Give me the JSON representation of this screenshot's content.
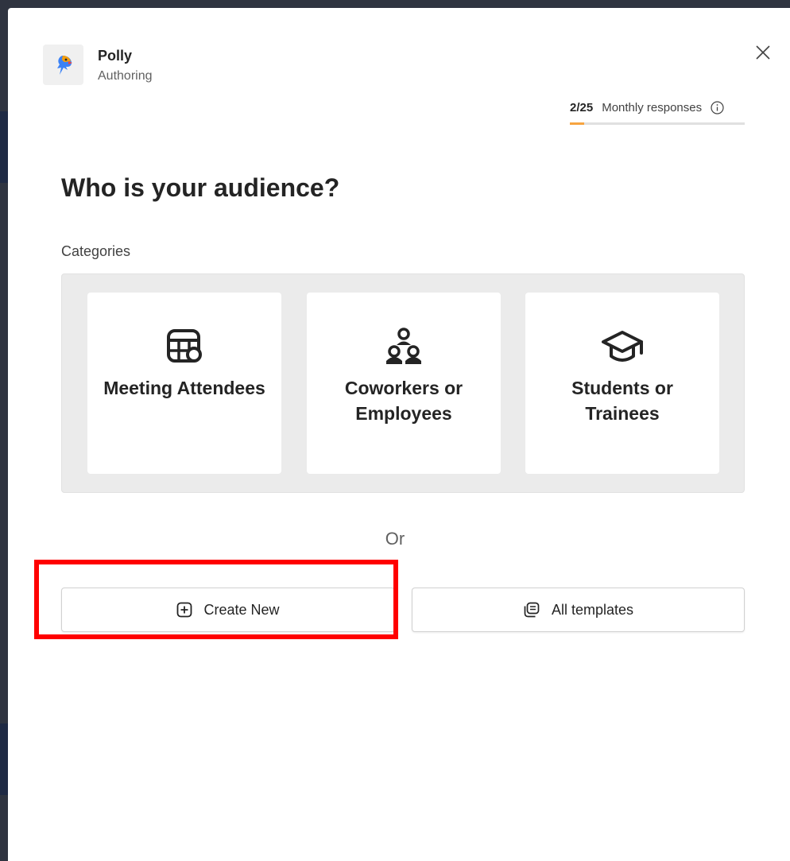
{
  "app": {
    "name": "Polly",
    "subtitle": "Authoring",
    "close_label": "Close",
    "logo_icon": "parrot-logo-icon"
  },
  "usage": {
    "count": "2/25",
    "label": "Monthly responses",
    "used_fraction": 0.08,
    "accent_color": "#f7a440"
  },
  "page": {
    "title": "Who is your audience?",
    "categories_label": "Categories",
    "or_text": "Or"
  },
  "categories": [
    {
      "label": "Meeting Attendees",
      "icon": "calendar-icon"
    },
    {
      "label": "Coworkers or Employees",
      "icon": "people-team-icon"
    },
    {
      "label": "Students or Trainees",
      "icon": "graduation-cap-icon"
    }
  ],
  "actions": {
    "create_new": {
      "label": "Create New",
      "icon": "add-square-icon"
    },
    "all_templates": {
      "label": "All templates",
      "icon": "templates-icon"
    }
  },
  "highlight_color": "#ff0000"
}
